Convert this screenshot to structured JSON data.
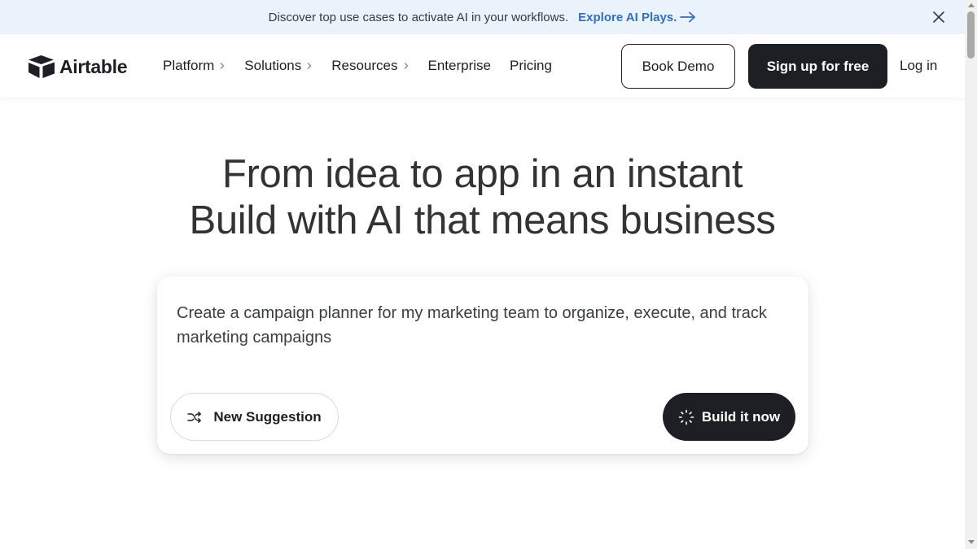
{
  "banner": {
    "message": "Discover top use cases to activate AI in your workflows.",
    "cta_label": "Explore AI Plays.",
    "cta_icon": "arrow-right-icon",
    "close_icon": "close-icon"
  },
  "header": {
    "logo_text": "Airtable",
    "nav": [
      {
        "label": "Platform",
        "has_submenu": true
      },
      {
        "label": "Solutions",
        "has_submenu": true
      },
      {
        "label": "Resources",
        "has_submenu": true
      },
      {
        "label": "Enterprise",
        "has_submenu": false
      },
      {
        "label": "Pricing",
        "has_submenu": false
      }
    ],
    "book_demo_label": "Book Demo",
    "signup_label": "Sign up for free",
    "login_label": "Log in"
  },
  "hero": {
    "title_line1": "From idea to app in an instant",
    "title_line2": "Build with AI that means business"
  },
  "prompt_card": {
    "prompt_text": "Create a campaign planner for my marketing team to organize, execute, and track marketing campaigns",
    "suggest_label": "New Suggestion",
    "suggest_icon": "shuffle-icon",
    "build_label": "Build it now",
    "build_icon": "loading-spinner-icon"
  },
  "colors": {
    "banner_bg": "#eaf2fc",
    "banner_link": "#2f6fc4",
    "primary_dark": "#1d1f25",
    "heading_text": "#333333"
  }
}
